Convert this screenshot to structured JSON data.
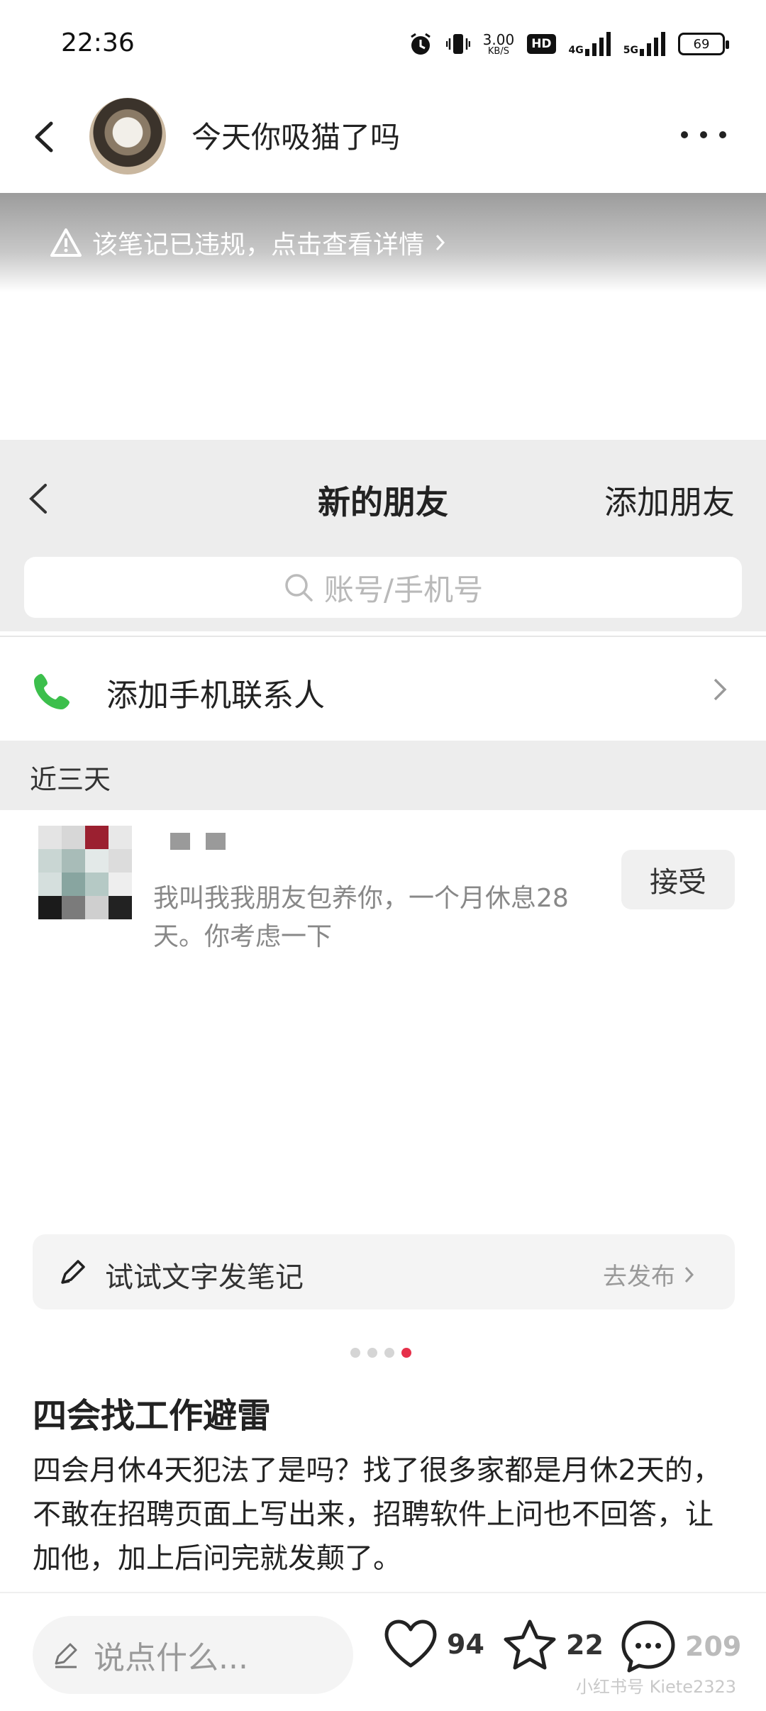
{
  "status_bar": {
    "time": "22:36",
    "net_speed": "3.00",
    "net_unit": "KB/S",
    "hd_label": "HD",
    "net_4g": "4G",
    "net_5g": "5G",
    "battery": "69"
  },
  "header": {
    "author": "今天你吸猫了吗"
  },
  "image": {
    "violation_notice": "该笔记已违规，点击查看详情"
  },
  "inner": {
    "title": "新的朋友",
    "add_friend": "添加朋友",
    "search_placeholder": "账号/手机号",
    "add_contacts": "添加手机联系人",
    "section_recent": "近三天",
    "request": {
      "message": "我叫我我朋友包养你，一个月休息28天。你考虑一下",
      "accept": "接受"
    }
  },
  "note_bar": {
    "label": "试试文字发笔记",
    "action": "去发布"
  },
  "carousel": {
    "count": 4,
    "active": 4
  },
  "post": {
    "title": "四会找工作避雷",
    "body": "四会月休4天犯法了是吗？找了很多家都是月休2天的，不敢在招聘页面上写出来，招聘软件上问也不回答，让加他，加上后问完就发颠了。"
  },
  "bottom_bar": {
    "comment_placeholder": "说点什么...",
    "likes": "94",
    "collects": "22",
    "comments": "209",
    "watermark": "小红书号 Kiete2323"
  },
  "colors": {
    "accent": "#e6304a",
    "call_green": "#3cbf4c"
  }
}
